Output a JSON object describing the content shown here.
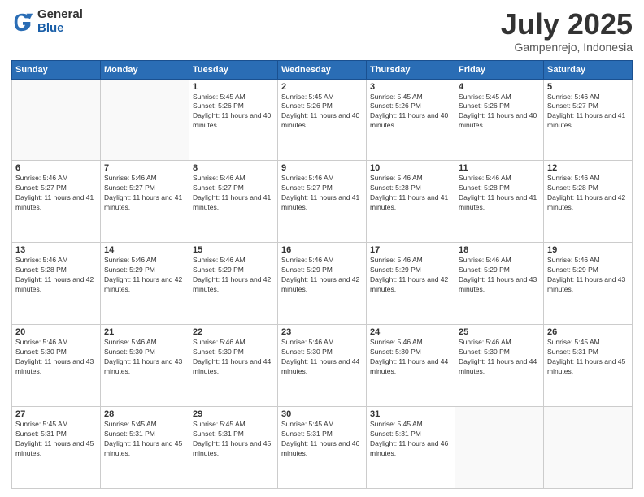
{
  "header": {
    "logo_general": "General",
    "logo_blue": "Blue",
    "month": "July 2025",
    "location": "Gampenrejo, Indonesia"
  },
  "days_of_week": [
    "Sunday",
    "Monday",
    "Tuesday",
    "Wednesday",
    "Thursday",
    "Friday",
    "Saturday"
  ],
  "weeks": [
    [
      {
        "day": "",
        "sunrise": "",
        "sunset": "",
        "daylight": "",
        "empty": true
      },
      {
        "day": "",
        "sunrise": "",
        "sunset": "",
        "daylight": "",
        "empty": true
      },
      {
        "day": "1",
        "sunrise": "Sunrise: 5:45 AM",
        "sunset": "Sunset: 5:26 PM",
        "daylight": "Daylight: 11 hours and 40 minutes.",
        "empty": false
      },
      {
        "day": "2",
        "sunrise": "Sunrise: 5:45 AM",
        "sunset": "Sunset: 5:26 PM",
        "daylight": "Daylight: 11 hours and 40 minutes.",
        "empty": false
      },
      {
        "day": "3",
        "sunrise": "Sunrise: 5:45 AM",
        "sunset": "Sunset: 5:26 PM",
        "daylight": "Daylight: 11 hours and 40 minutes.",
        "empty": false
      },
      {
        "day": "4",
        "sunrise": "Sunrise: 5:45 AM",
        "sunset": "Sunset: 5:26 PM",
        "daylight": "Daylight: 11 hours and 40 minutes.",
        "empty": false
      },
      {
        "day": "5",
        "sunrise": "Sunrise: 5:46 AM",
        "sunset": "Sunset: 5:27 PM",
        "daylight": "Daylight: 11 hours and 41 minutes.",
        "empty": false
      }
    ],
    [
      {
        "day": "6",
        "sunrise": "Sunrise: 5:46 AM",
        "sunset": "Sunset: 5:27 PM",
        "daylight": "Daylight: 11 hours and 41 minutes.",
        "empty": false
      },
      {
        "day": "7",
        "sunrise": "Sunrise: 5:46 AM",
        "sunset": "Sunset: 5:27 PM",
        "daylight": "Daylight: 11 hours and 41 minutes.",
        "empty": false
      },
      {
        "day": "8",
        "sunrise": "Sunrise: 5:46 AM",
        "sunset": "Sunset: 5:27 PM",
        "daylight": "Daylight: 11 hours and 41 minutes.",
        "empty": false
      },
      {
        "day": "9",
        "sunrise": "Sunrise: 5:46 AM",
        "sunset": "Sunset: 5:27 PM",
        "daylight": "Daylight: 11 hours and 41 minutes.",
        "empty": false
      },
      {
        "day": "10",
        "sunrise": "Sunrise: 5:46 AM",
        "sunset": "Sunset: 5:28 PM",
        "daylight": "Daylight: 11 hours and 41 minutes.",
        "empty": false
      },
      {
        "day": "11",
        "sunrise": "Sunrise: 5:46 AM",
        "sunset": "Sunset: 5:28 PM",
        "daylight": "Daylight: 11 hours and 41 minutes.",
        "empty": false
      },
      {
        "day": "12",
        "sunrise": "Sunrise: 5:46 AM",
        "sunset": "Sunset: 5:28 PM",
        "daylight": "Daylight: 11 hours and 42 minutes.",
        "empty": false
      }
    ],
    [
      {
        "day": "13",
        "sunrise": "Sunrise: 5:46 AM",
        "sunset": "Sunset: 5:28 PM",
        "daylight": "Daylight: 11 hours and 42 minutes.",
        "empty": false
      },
      {
        "day": "14",
        "sunrise": "Sunrise: 5:46 AM",
        "sunset": "Sunset: 5:29 PM",
        "daylight": "Daylight: 11 hours and 42 minutes.",
        "empty": false
      },
      {
        "day": "15",
        "sunrise": "Sunrise: 5:46 AM",
        "sunset": "Sunset: 5:29 PM",
        "daylight": "Daylight: 11 hours and 42 minutes.",
        "empty": false
      },
      {
        "day": "16",
        "sunrise": "Sunrise: 5:46 AM",
        "sunset": "Sunset: 5:29 PM",
        "daylight": "Daylight: 11 hours and 42 minutes.",
        "empty": false
      },
      {
        "day": "17",
        "sunrise": "Sunrise: 5:46 AM",
        "sunset": "Sunset: 5:29 PM",
        "daylight": "Daylight: 11 hours and 42 minutes.",
        "empty": false
      },
      {
        "day": "18",
        "sunrise": "Sunrise: 5:46 AM",
        "sunset": "Sunset: 5:29 PM",
        "daylight": "Daylight: 11 hours and 43 minutes.",
        "empty": false
      },
      {
        "day": "19",
        "sunrise": "Sunrise: 5:46 AM",
        "sunset": "Sunset: 5:29 PM",
        "daylight": "Daylight: 11 hours and 43 minutes.",
        "empty": false
      }
    ],
    [
      {
        "day": "20",
        "sunrise": "Sunrise: 5:46 AM",
        "sunset": "Sunset: 5:30 PM",
        "daylight": "Daylight: 11 hours and 43 minutes.",
        "empty": false
      },
      {
        "day": "21",
        "sunrise": "Sunrise: 5:46 AM",
        "sunset": "Sunset: 5:30 PM",
        "daylight": "Daylight: 11 hours and 43 minutes.",
        "empty": false
      },
      {
        "day": "22",
        "sunrise": "Sunrise: 5:46 AM",
        "sunset": "Sunset: 5:30 PM",
        "daylight": "Daylight: 11 hours and 44 minutes.",
        "empty": false
      },
      {
        "day": "23",
        "sunrise": "Sunrise: 5:46 AM",
        "sunset": "Sunset: 5:30 PM",
        "daylight": "Daylight: 11 hours and 44 minutes.",
        "empty": false
      },
      {
        "day": "24",
        "sunrise": "Sunrise: 5:46 AM",
        "sunset": "Sunset: 5:30 PM",
        "daylight": "Daylight: 11 hours and 44 minutes.",
        "empty": false
      },
      {
        "day": "25",
        "sunrise": "Sunrise: 5:46 AM",
        "sunset": "Sunset: 5:30 PM",
        "daylight": "Daylight: 11 hours and 44 minutes.",
        "empty": false
      },
      {
        "day": "26",
        "sunrise": "Sunrise: 5:45 AM",
        "sunset": "Sunset: 5:31 PM",
        "daylight": "Daylight: 11 hours and 45 minutes.",
        "empty": false
      }
    ],
    [
      {
        "day": "27",
        "sunrise": "Sunrise: 5:45 AM",
        "sunset": "Sunset: 5:31 PM",
        "daylight": "Daylight: 11 hours and 45 minutes.",
        "empty": false
      },
      {
        "day": "28",
        "sunrise": "Sunrise: 5:45 AM",
        "sunset": "Sunset: 5:31 PM",
        "daylight": "Daylight: 11 hours and 45 minutes.",
        "empty": false
      },
      {
        "day": "29",
        "sunrise": "Sunrise: 5:45 AM",
        "sunset": "Sunset: 5:31 PM",
        "daylight": "Daylight: 11 hours and 45 minutes.",
        "empty": false
      },
      {
        "day": "30",
        "sunrise": "Sunrise: 5:45 AM",
        "sunset": "Sunset: 5:31 PM",
        "daylight": "Daylight: 11 hours and 46 minutes.",
        "empty": false
      },
      {
        "day": "31",
        "sunrise": "Sunrise: 5:45 AM",
        "sunset": "Sunset: 5:31 PM",
        "daylight": "Daylight: 11 hours and 46 minutes.",
        "empty": false
      },
      {
        "day": "",
        "sunrise": "",
        "sunset": "",
        "daylight": "",
        "empty": true
      },
      {
        "day": "",
        "sunrise": "",
        "sunset": "",
        "daylight": "",
        "empty": true
      }
    ]
  ]
}
